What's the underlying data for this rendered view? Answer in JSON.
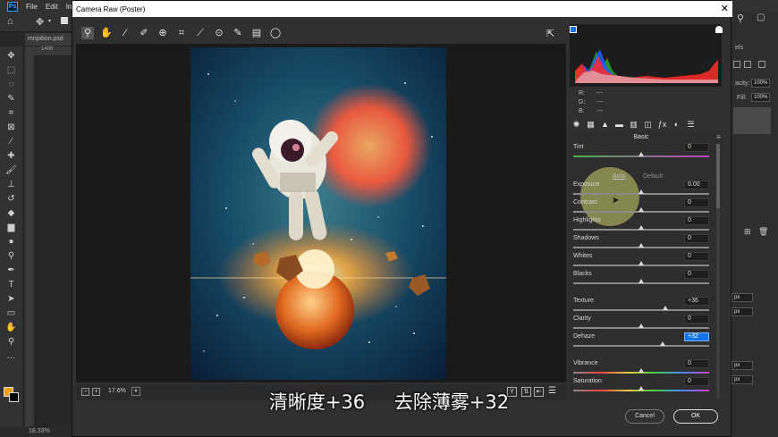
{
  "photoshop": {
    "menu": [
      "File",
      "Edit",
      "Imag"
    ],
    "doc_tab": "mnpition.psd",
    "ruler_mark": "1400",
    "status": "18.33%",
    "right_panel": {
      "frag1": "els",
      "opacity_label": "acity:",
      "opacity_value": "100%",
      "fill_label": "Fill:",
      "fill_value": "100%",
      "unit1": "px",
      "unit2": "px",
      "unit3": "px",
      "unit4": "px"
    },
    "colors": {
      "foreground": "#f0a000",
      "background": "#000000"
    }
  },
  "camera_raw": {
    "title": "Camera Raw (Poster)",
    "toolbar_icons": [
      "zoom-icon",
      "hand-icon",
      "white-balance-icon",
      "color-sampler-icon",
      "target-adjust-icon",
      "crop-icon",
      "straighten-icon",
      "red-eye-icon",
      "brush-icon",
      "graduated-filter-icon",
      "radial-filter-icon"
    ],
    "readout": {
      "r_label": "R:",
      "g_label": "G:",
      "b_label": "B:",
      "r": "---",
      "g": "---",
      "b": "---"
    },
    "panel": {
      "title": "Basic",
      "auto_label": "Auto",
      "default_label": "Default",
      "sliders": [
        {
          "label": "Tint",
          "value": "0",
          "level": 0.5
        },
        {
          "label": "Exposure",
          "value": "0.00",
          "level": 0.5
        },
        {
          "label": "Contrast",
          "value": "0",
          "level": 0.5
        },
        {
          "label": "Highlights",
          "value": "0",
          "level": 0.5
        },
        {
          "label": "Shadows",
          "value": "0",
          "level": 0.5
        },
        {
          "label": "Whites",
          "value": "0",
          "level": 0.5
        },
        {
          "label": "Blacks",
          "value": "0",
          "level": 0.5
        },
        {
          "label": "Texture",
          "value": "+36",
          "level": 0.68
        },
        {
          "label": "Clarity",
          "value": "0",
          "level": 0.5
        },
        {
          "label": "Dehaze",
          "value": "+32",
          "level": 0.66
        },
        {
          "label": "Vibrance",
          "value": "0",
          "level": 0.5
        },
        {
          "label": "Saturation",
          "value": "0",
          "level": 0.5
        }
      ]
    },
    "zoom": "17.6%",
    "buttons": {
      "cancel": "Cancel",
      "ok": "OK"
    }
  },
  "subtitle": "清晰度+36 去除薄雾+32"
}
